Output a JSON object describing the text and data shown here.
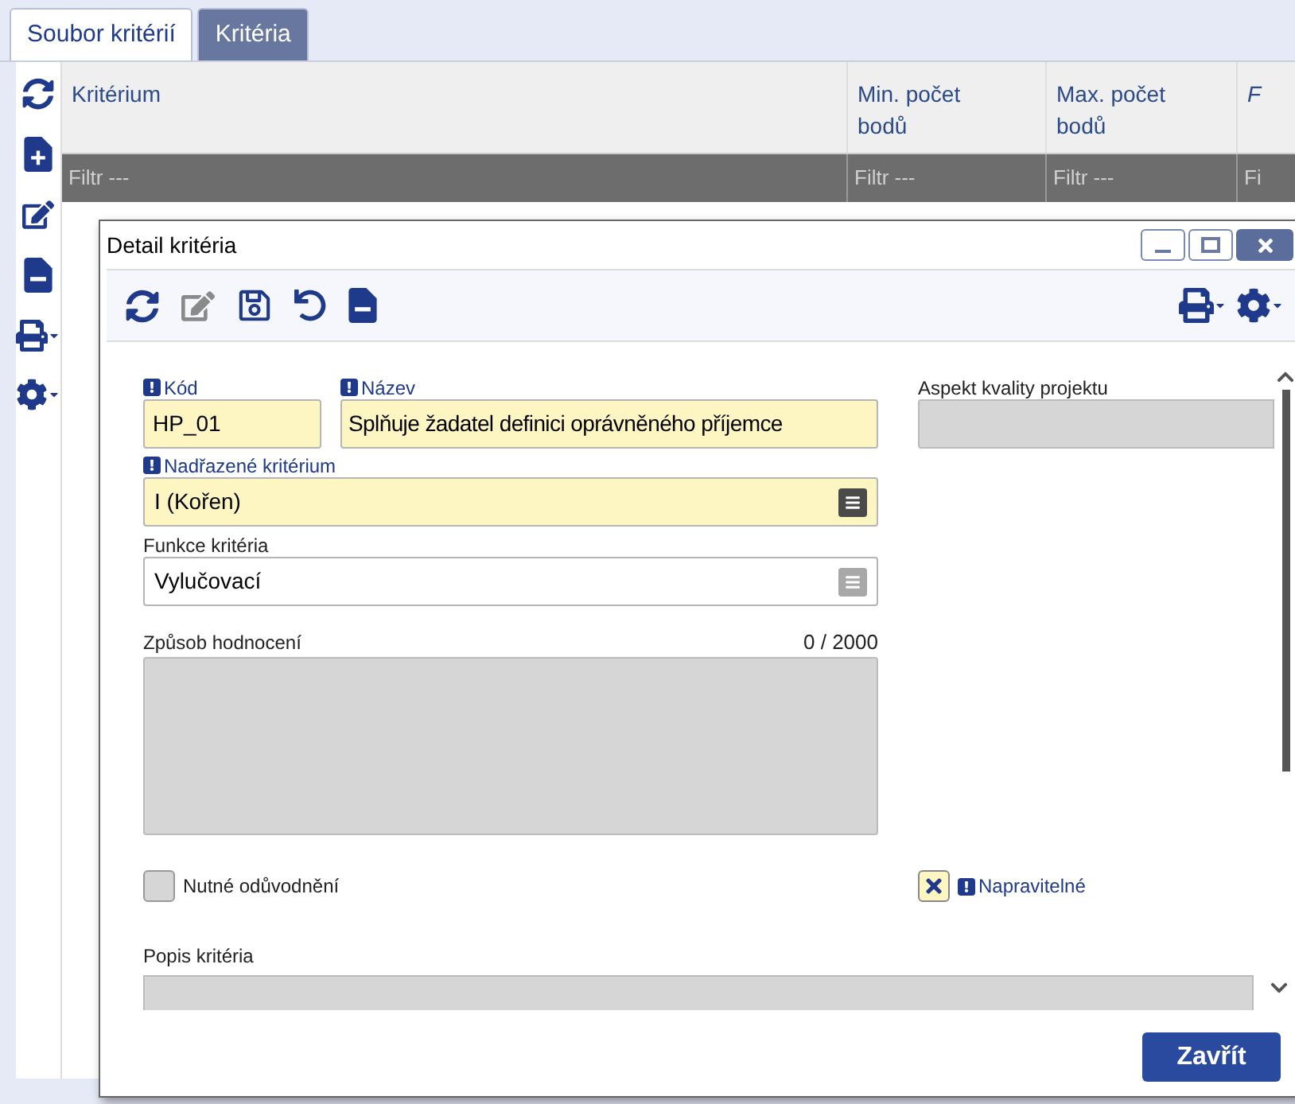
{
  "tabs": [
    {
      "label": "Soubor kritérií",
      "selected": false
    },
    {
      "label": "Kritéria",
      "selected": true
    }
  ],
  "table": {
    "columns": [
      {
        "label": "Kritérium",
        "italic": false
      },
      {
        "label": "Min. počet bodů",
        "italic": false
      },
      {
        "label": "Max. počet bodů",
        "italic": false
      },
      {
        "label": "F",
        "italic": true
      }
    ],
    "filters": [
      "Filtr ---",
      "Filtr ---",
      "Filtr ---",
      "Fi"
    ]
  },
  "dialog": {
    "title": "Detail kritéria",
    "code": {
      "label": "Kód",
      "required": true,
      "value": "HP_01"
    },
    "name": {
      "label": "Název",
      "required": true,
      "value": "Splňuje žadatel definici oprávněného příjemce"
    },
    "parent": {
      "label": "Nadřazené kritérium",
      "required": true,
      "value": "I (Kořen)",
      "disabled": false
    },
    "function": {
      "label": "Funkce kritéria",
      "required": false,
      "value": "Vylučovací",
      "disabled": true
    },
    "method": {
      "label": "Způsob hodnocení",
      "counter": "0 / 2000"
    },
    "aspect": {
      "label": "Aspekt kvality projektu"
    },
    "checkboxes": [
      {
        "label": "Nutné odůvodnění",
        "checked": false,
        "required": false
      },
      {
        "label": "Napravitelné",
        "checked": true,
        "required": true
      }
    ],
    "description": {
      "label": "Popis kritéria"
    },
    "close_button": "Zavřít"
  }
}
